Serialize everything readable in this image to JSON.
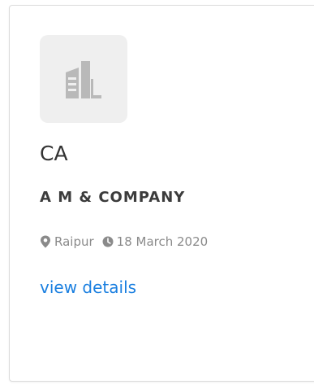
{
  "card": {
    "logo_icon": "building-icon",
    "role": "CA",
    "company": "A M & COMPANY",
    "location_icon": "map-pin-icon",
    "location": "Raipur",
    "date_icon": "clock-icon",
    "date": "18 March 2020",
    "link_label": "view details"
  },
  "colors": {
    "link": "#1a7fe0",
    "meta_text": "#8a8a8a",
    "logo_bg": "#efefef"
  }
}
